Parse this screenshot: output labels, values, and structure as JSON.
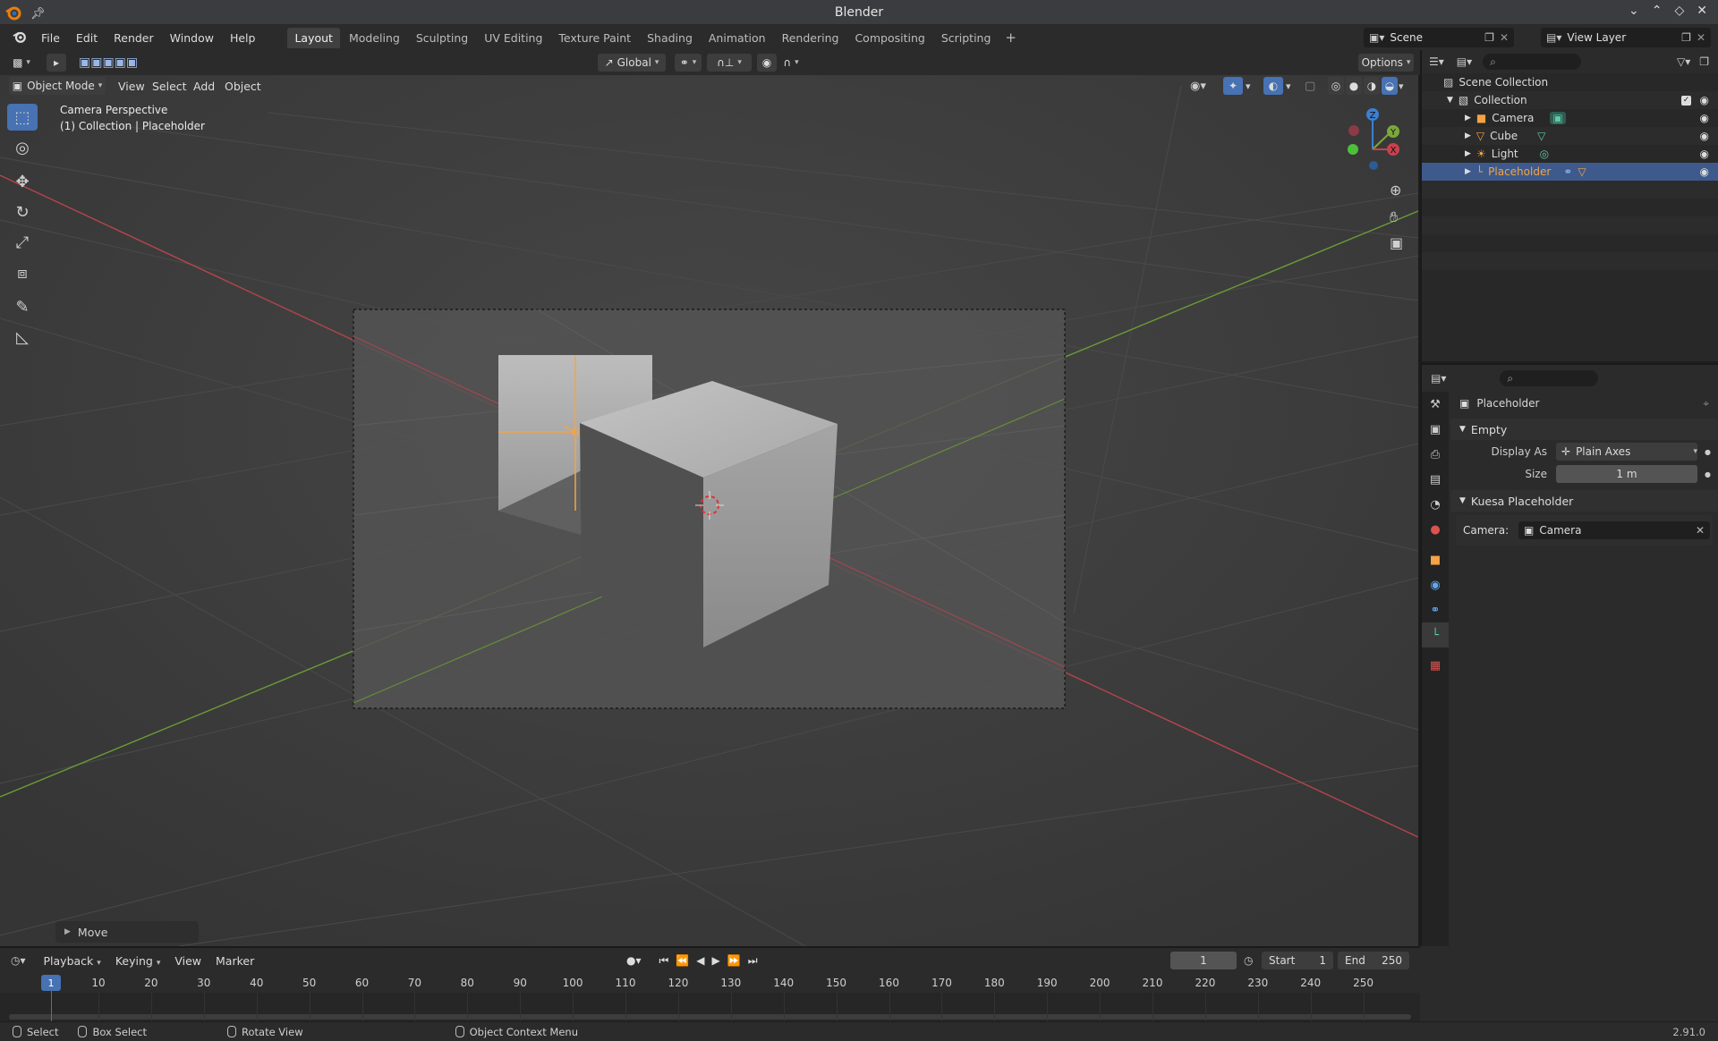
{
  "window": {
    "title": "Blender"
  },
  "menus": [
    "File",
    "Edit",
    "Render",
    "Window",
    "Help"
  ],
  "workspaces": [
    "Layout",
    "Modeling",
    "Sculpting",
    "UV Editing",
    "Texture Paint",
    "Shading",
    "Animation",
    "Rendering",
    "Compositing",
    "Scripting"
  ],
  "active_workspace": "Layout",
  "scene": {
    "name": "Scene"
  },
  "view_layer": {
    "name": "View Layer"
  },
  "viewport": {
    "transform_orientation": "Global",
    "options_label": "Options",
    "mode": "Object Mode",
    "header_menus": [
      "View",
      "Select",
      "Add",
      "Object"
    ],
    "overlay_line1": "Camera Perspective",
    "overlay_line2": "(1) Collection | Placeholder",
    "gizmo_axes": {
      "x": "X",
      "y": "Y",
      "z": "Z"
    },
    "last_operator": "Move"
  },
  "outliner": {
    "root": "Scene Collection",
    "collection": "Collection",
    "items": [
      {
        "name": "Camera",
        "icon": "camera-icon",
        "color": "#f5a344"
      },
      {
        "name": "Cube",
        "icon": "mesh-icon",
        "color": "#f5a344"
      },
      {
        "name": "Light",
        "icon": "light-icon",
        "color": "#f5a344"
      },
      {
        "name": "Placeholder",
        "icon": "empty-icon",
        "color": "#f5a344",
        "selected": true
      }
    ]
  },
  "properties": {
    "object_name": "Placeholder",
    "empty_panel": {
      "title": "Empty",
      "display_as_label": "Display As",
      "display_as_value": "Plain Axes",
      "size_label": "Size",
      "size_value": "1 m"
    },
    "addon_panel": {
      "title": "Kuesa Placeholder",
      "camera_label": "Camera:",
      "camera_value": "Camera"
    }
  },
  "timeline": {
    "menus": [
      "Playback",
      "Keying",
      "View",
      "Marker"
    ],
    "current_frame": "1",
    "start_label": "Start",
    "start_value": "1",
    "end_label": "End",
    "end_value": "250",
    "ruler": [
      "1",
      "10",
      "20",
      "30",
      "40",
      "50",
      "60",
      "70",
      "80",
      "90",
      "100",
      "110",
      "120",
      "130",
      "140",
      "150",
      "160",
      "170",
      "180",
      "190",
      "200",
      "210",
      "220",
      "230",
      "240",
      "250"
    ]
  },
  "statusbar": {
    "select": "Select",
    "box_select": "Box Select",
    "rotate_view": "Rotate View",
    "context_menu": "Object Context Menu",
    "version": "2.91.0"
  },
  "colors": {
    "accent": "#4772b3",
    "selected_object": "#f5a344",
    "x_axis": "#c9414e",
    "y_axis": "#7ba83a",
    "z_axis": "#3d7fd1"
  }
}
